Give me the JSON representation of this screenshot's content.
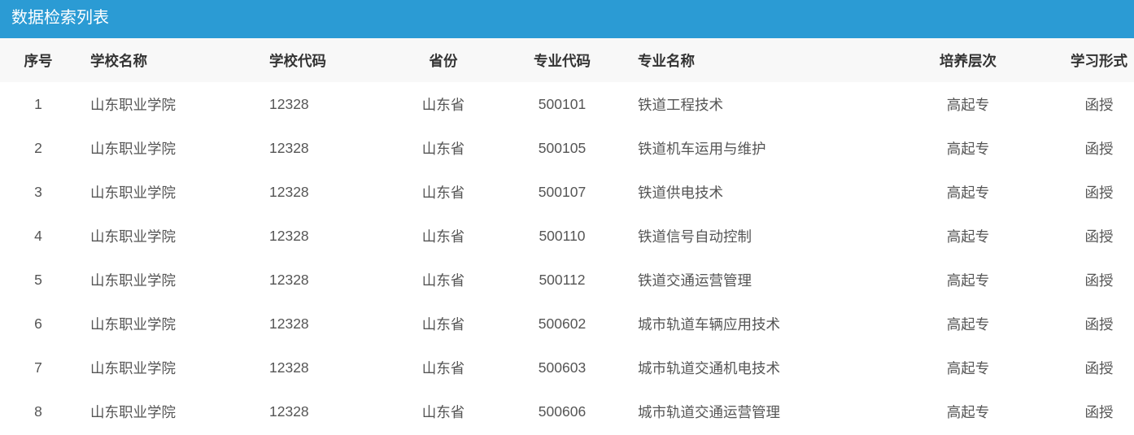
{
  "header": {
    "title": "数据检索列表"
  },
  "colors": {
    "title_bar": "#2b9bd4",
    "header_row_bg": "#f8f8f8",
    "header_text": "#333333",
    "body_text": "#555555"
  },
  "table": {
    "columns": [
      "序号",
      "学校名称",
      "学校代码",
      "省份",
      "专业代码",
      "专业名称",
      "培养层次",
      "学习形式"
    ],
    "rows": [
      [
        "1",
        "山东职业学院",
        "12328",
        "山东省",
        "500101",
        "铁道工程技术",
        "高起专",
        "函授"
      ],
      [
        "2",
        "山东职业学院",
        "12328",
        "山东省",
        "500105",
        "铁道机车运用与维护",
        "高起专",
        "函授"
      ],
      [
        "3",
        "山东职业学院",
        "12328",
        "山东省",
        "500107",
        "铁道供电技术",
        "高起专",
        "函授"
      ],
      [
        "4",
        "山东职业学院",
        "12328",
        "山东省",
        "500110",
        "铁道信号自动控制",
        "高起专",
        "函授"
      ],
      [
        "5",
        "山东职业学院",
        "12328",
        "山东省",
        "500112",
        "铁道交通运营管理",
        "高起专",
        "函授"
      ],
      [
        "6",
        "山东职业学院",
        "12328",
        "山东省",
        "500602",
        "城市轨道车辆应用技术",
        "高起专",
        "函授"
      ],
      [
        "7",
        "山东职业学院",
        "12328",
        "山东省",
        "500603",
        "城市轨道交通机电技术",
        "高起专",
        "函授"
      ],
      [
        "8",
        "山东职业学院",
        "12328",
        "山东省",
        "500606",
        "城市轨道交通运营管理",
        "高起专",
        "函授"
      ]
    ]
  }
}
